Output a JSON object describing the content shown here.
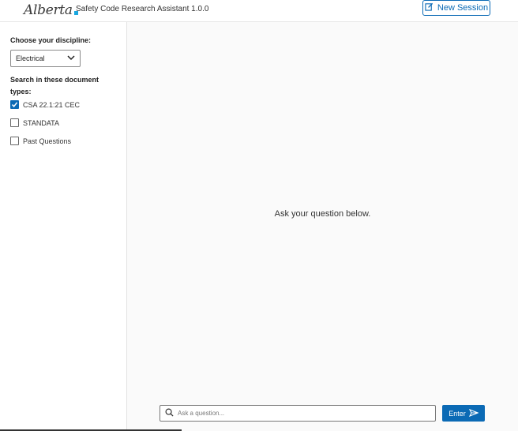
{
  "header": {
    "logo_text": "Alberta",
    "app_title": "Safety Code Research Assistant 1.0.0",
    "new_session_label": "New Session",
    "new_session_icon": "edit-icon"
  },
  "sidebar": {
    "discipline_label": "Choose your discipline:",
    "discipline_selected": "Electrical",
    "doc_types_label_line1": "Search in these document",
    "doc_types_label_line2": "types:",
    "doc_types": [
      {
        "label": "CSA 22.1:21 CEC",
        "checked": true
      },
      {
        "label": "STANDATA",
        "checked": false
      },
      {
        "label": "Past Questions",
        "checked": false
      }
    ]
  },
  "main": {
    "prompt": "Ask your question below.",
    "search_placeholder": "Ask a question...",
    "search_value": "",
    "enter_label": "Enter"
  },
  "colors": {
    "accent": "#0b6ab5",
    "logo_mark": "#1aa7df"
  }
}
